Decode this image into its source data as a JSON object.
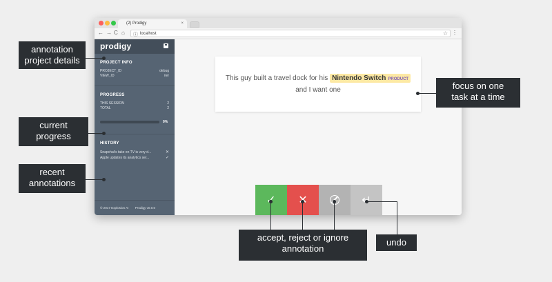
{
  "browser": {
    "tab_title": "(2) Prodigy",
    "tab_close": "×",
    "url": "localhost",
    "nav_back": "←",
    "nav_forward": "→",
    "nav_reload": "C",
    "nav_home": "⌂",
    "url_info": "ⓘ",
    "star": "☆",
    "menu": "⋮"
  },
  "sidebar": {
    "logo": "prodigy",
    "project_info": {
      "title": "PROJECT INFO",
      "rows": [
        {
          "key": "PROJECT_ID",
          "value": "debug"
        },
        {
          "key": "VIEW_ID",
          "value": "ner"
        }
      ]
    },
    "progress": {
      "title": "PROGRESS",
      "rows": [
        {
          "key": "THIS SESSION",
          "value": "2"
        },
        {
          "key": "TOTAL",
          "value": "2"
        }
      ],
      "percent_label": "0%",
      "fraction": 0
    },
    "history": {
      "title": "HISTORY",
      "items": [
        {
          "text": "Snapchat's take on TV is very d...",
          "mark": "✕"
        },
        {
          "text": "Apple updates its analytics ser...",
          "mark": "✓"
        }
      ]
    },
    "footer": {
      "copyright": "© 2017 Explosion AI",
      "version": "Prodigy v0.0.0"
    }
  },
  "task": {
    "text_before": "This guy built a travel dock for his",
    "entity_text": "Nintendo Switch",
    "entity_label": "PRODUCT",
    "text_after": "and I want one"
  },
  "actions": {
    "accept": "✓",
    "reject": "✕",
    "undo": "↵"
  },
  "annotations": {
    "project_details": [
      "annotation",
      "project details"
    ],
    "current_progress": [
      "current",
      "progress"
    ],
    "recent_annotations": [
      "recent",
      "annotations"
    ],
    "focus": [
      "focus on one",
      "task at a time"
    ],
    "decide": [
      "accept, reject or ignore",
      "annotation"
    ],
    "undo": "undo"
  },
  "colors": {
    "sidebar_bg": "#566473",
    "sidebar_header": "#434e5a",
    "accept": "#5cb85c",
    "reject": "#e4504d",
    "ignore": "#b3b3b3",
    "undo": "#c4c4c4",
    "entity_highlight": "#fde9a4",
    "callout_bg": "#2b2f33"
  }
}
